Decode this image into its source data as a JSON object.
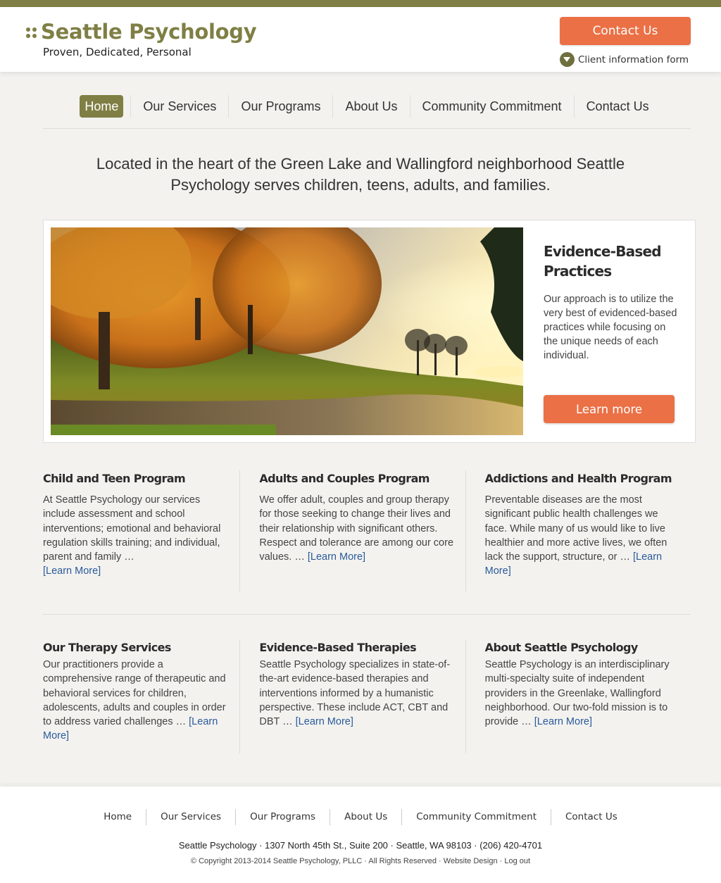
{
  "header": {
    "brand": "Seattle Psychology",
    "tagline": "Proven, Dedicated, Personal",
    "contact_button": "Contact Us",
    "client_form_link": "Client information form"
  },
  "nav": {
    "items": [
      {
        "label": "Home",
        "active": true
      },
      {
        "label": "Our Services"
      },
      {
        "label": "Our Programs"
      },
      {
        "label": "About Us"
      },
      {
        "label": "Community Commitment"
      },
      {
        "label": "Contact Us"
      }
    ]
  },
  "intro": "Located in the heart of the Green Lake and Wallingford neighborhood Seattle Psychology serves children, teens, adults, and families.",
  "feature": {
    "image_description": "Autumn park path with golden trees and sunset over lake",
    "title": "Evidence-Based Practices",
    "body": "Our approach is to utilize the very best of evidenced-based practices while focusing on the unique needs of each individual.",
    "button": "Learn more"
  },
  "programs": [
    {
      "title": "Child and Teen Program",
      "body": "At Seattle Psychology our services include assessment and school interventions; emotional and behavioral regulation skills training; and individual, parent and family …",
      "link": "[Learn More]"
    },
    {
      "title": "Adults and Couples Program",
      "body": "We offer adult, couples and group therapy for those seeking to change their lives and their relationship with significant others. Respect and tolerance are among our core values. …",
      "link": "[Learn More]"
    },
    {
      "title": "Addictions and Health Program",
      "body": "Preventable diseases are the most significant public health challenges we face. While many of us would like to live healthier and more active lives, we often lack the support, structure, or …",
      "link": "[Learn More]"
    }
  ],
  "services": [
    {
      "title": "Our Therapy Services",
      "body": "Our practitioners provide a comprehensive range of therapeutic and behavioral services for children, adolescents, adults and couples in order to address varied challenges …",
      "link": "[Learn More]"
    },
    {
      "title": "Evidence-Based Therapies",
      "body": "Seattle Psychology specializes in state-of-the-art evidence-based therapies and interventions informed by a humanistic perspective. These include ACT, CBT and DBT …",
      "link": "[Learn More]"
    },
    {
      "title": "About Seattle Psychology",
      "body": "Seattle Psychology is an interdisciplinary multi-specialty suite of independent providers in the Greenlake, Wallingford neighborhood. Our two-fold mission is to provide …",
      "link": "[Learn More]"
    }
  ],
  "footer": {
    "nav": [
      "Home",
      "Our Services",
      "Our Programs",
      "About Us",
      "Community Commitment",
      "Contact Us"
    ],
    "address": "Seattle Psychology · 1307 North 45th St., Suite 200 · Seattle, WA 98103 · (206) 420-4701",
    "copyright": "© Copyright 2013-2014 Seattle Psychology, PLLC · All Rights Reserved · ",
    "website_design": "Website Design",
    "separator": " · ",
    "logout": "Log out"
  },
  "colors": {
    "brand_olive": "#7f7f45",
    "accent_orange": "#eb7046",
    "link_blue": "#2a5a9a"
  }
}
